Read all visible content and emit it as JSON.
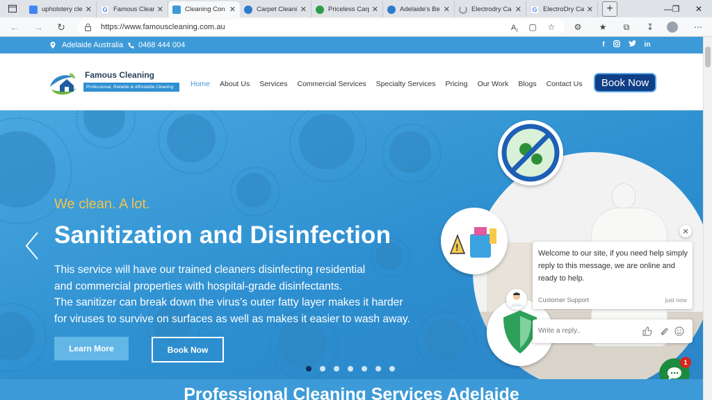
{
  "browser": {
    "tabs": [
      {
        "title": "upholstery cle",
        "favicon": "docs-icon",
        "color": "#4285f4"
      },
      {
        "title": "Famous Clean",
        "favicon": "google-icon",
        "color": "#ffffff"
      },
      {
        "title": "Cleaning Con",
        "favicon": "site-icon",
        "color": "#3d9ad8",
        "active": true
      },
      {
        "title": "Carpet Cleani",
        "favicon": "globe-icon",
        "color": "#2b7cc9"
      },
      {
        "title": "Priceless Carp",
        "favicon": "refresh-icon",
        "color": "#2e9b4a"
      },
      {
        "title": "Adelaide's Be",
        "favicon": "globe-icon",
        "color": "#2b7cc9"
      },
      {
        "title": "Electrodry Ca",
        "favicon": "loading-icon",
        "color": "#999999"
      },
      {
        "title": "ElectroDry Ca",
        "favicon": "google-icon",
        "color": "#ffffff"
      }
    ],
    "url": "https://www.famouscleaning.com.au"
  },
  "topbar": {
    "location": "Adelaide Australia",
    "phone": "0468 444 004",
    "social": [
      "f",
      "ig",
      "t",
      "in"
    ]
  },
  "header": {
    "logo_name": "Famous Cleaning",
    "logo_tagline": "Professional, Reliable & Affordable Cleaning",
    "nav": [
      "Home",
      "About Us",
      "Services",
      "Commercial Services",
      "Specialty Services",
      "Pricing",
      "Our Work",
      "Blogs",
      "Contact Us"
    ],
    "book_now": "Book Now"
  },
  "hero": {
    "tagline": "We clean. A lot.",
    "title": "Sanitization and Disinfection",
    "description_lines": [
      "This service will have our trained cleaners disinfecting residential",
      "and commercial properties with hospital-grade disinfectants.",
      "The sanitizer can break down the virus’s outer fatty layer makes it harder",
      "for viruses to survive on surfaces as well as makes it easier to wash away."
    ],
    "learn_more": "Learn More",
    "book_now": "Book Now",
    "slide_count": 7,
    "active_slide": 1
  },
  "chat": {
    "message": "Welcome to our site, if you need help simply reply to this message, we are online and ready to help.",
    "author": "Customer Support",
    "time": "just now",
    "reply_placeholder": "Write a reply..",
    "unread": "1"
  },
  "section": {
    "title": "Professional Cleaning Services Adelaide"
  },
  "colors": {
    "brand_blue": "#3d9ad8",
    "navy": "#0f3f86",
    "accent_yellow": "#f3c24c",
    "chat_green": "#1c8a3f"
  }
}
